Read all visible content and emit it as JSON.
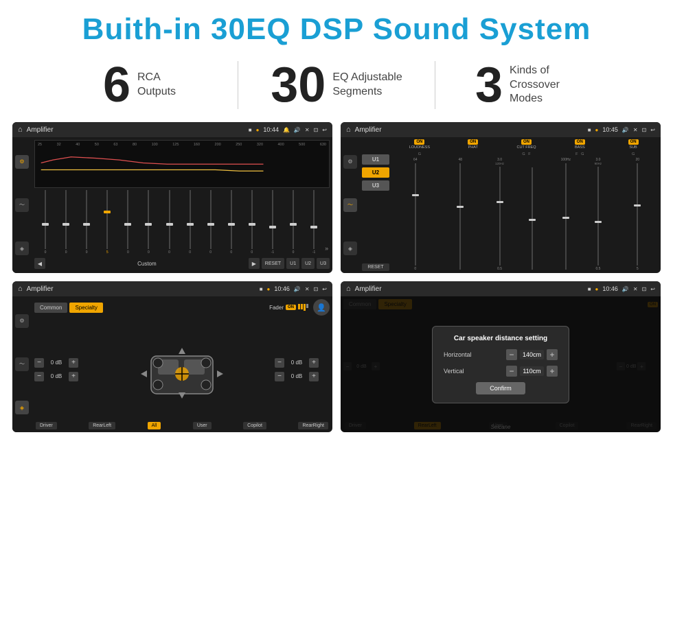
{
  "header": {
    "title": "Buith-in 30EQ DSP Sound System"
  },
  "stats": [
    {
      "number": "6",
      "label": "RCA\nOutputs"
    },
    {
      "number": "30",
      "label": "EQ Adjustable\nSegments"
    },
    {
      "number": "3",
      "label": "Kinds of\nCrossover Modes"
    }
  ],
  "screen1": {
    "title": "Amplifier",
    "time": "10:44",
    "freq_labels": [
      "25",
      "32",
      "40",
      "50",
      "63",
      "80",
      "100",
      "125",
      "160",
      "200",
      "250",
      "320",
      "400",
      "500",
      "630"
    ],
    "slider_values": [
      "0",
      "0",
      "0",
      "5",
      "0",
      "0",
      "0",
      "0",
      "0",
      "0",
      "0",
      "-1",
      "0",
      "-1"
    ],
    "buttons": [
      "Custom",
      "RESET",
      "U1",
      "U2",
      "U3"
    ]
  },
  "screen2": {
    "title": "Amplifier",
    "time": "10:45",
    "u_buttons": [
      "U1",
      "U2",
      "U3"
    ],
    "on_labels": [
      "LOUDNESS",
      "PHAT",
      "CUT FREQ",
      "BASS",
      "SUB"
    ],
    "reset": "RESET"
  },
  "screen3": {
    "title": "Amplifier",
    "time": "10:46",
    "tabs": [
      "Common",
      "Specialty"
    ],
    "fader_label": "Fader",
    "db_values": [
      "0 dB",
      "0 dB",
      "0 dB",
      "0 dB"
    ],
    "buttons": [
      "Driver",
      "RearLeft",
      "All",
      "User",
      "Copilot",
      "RearRight"
    ]
  },
  "screen4": {
    "title": "Amplifier",
    "time": "10:46",
    "dialog": {
      "title": "Car speaker distance setting",
      "horizontal_label": "Horizontal",
      "horizontal_value": "140cm",
      "vertical_label": "Vertical",
      "vertical_value": "110cm",
      "confirm_label": "Confirm"
    },
    "tabs": [
      "Common",
      "Specialty"
    ],
    "buttons": [
      "Driver",
      "RearLeft",
      "User",
      "Copilot",
      "RearRight"
    ],
    "db_right": "0 dB"
  },
  "watermark": "Seicane"
}
